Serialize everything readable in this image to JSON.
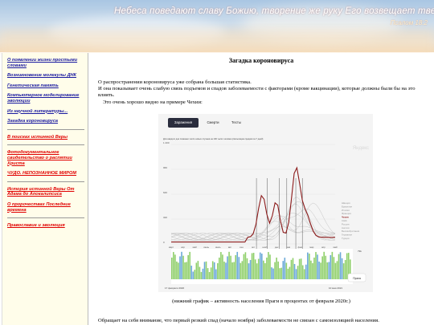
{
  "header": {
    "quote": "Небеса поведают славу Божию, творение же руку Его возвещает твердь",
    "reference": "Псалом 18:2"
  },
  "sidebar": {
    "items": [
      {
        "label": "О появлении жизни простыми словами",
        "color": "blue"
      },
      {
        "label": "Возникновение молекулы ДНК",
        "color": "blue"
      },
      {
        "label": "Генетическая память",
        "color": "blue"
      },
      {
        "label": "Компьютерное моделирование эволюции",
        "color": "blue"
      },
      {
        "label": "Из научной литературы...",
        "color": "blue"
      },
      {
        "label": "Загадка короновируса",
        "color": "blue"
      },
      {
        "label": "В поисках истинной Веры",
        "color": "red"
      },
      {
        "label": "Фотодокументальное свидетельство о распятии Христа",
        "color": "red"
      },
      {
        "label": "ЧУДО. НЕПОЗНАННОЕ МИРОМ",
        "color": "red"
      },
      {
        "label": "История истинной Веры От Адама до Апокалипсиса",
        "color": "red"
      },
      {
        "label": "О пророчествах Последние времена",
        "color": "red"
      },
      {
        "label": "Православие и эволюция",
        "color": "red"
      }
    ]
  },
  "main": {
    "title": "Загадка короновируса",
    "para1": "О распространении короновируса уже собрана большая статистика.",
    "para2": "И она показывает очень слабую связь подъемов и спадов заболеваемости с факторами (кроме вакцинации), которые должны были бы на это влиять.",
    "para3": "Это очень хорошо видно на примере Чехии:",
    "caption": "(нижний график – активность населения Праги в процентах от февраля 2020г.)",
    "bottom": "Обращает на себя внимание, что первый резкий спад (начало ноября) заболеваемости не связан с самоизоляцией населения."
  },
  "chart": {
    "tabs": [
      "Заражения",
      "Смерти",
      "Тесты"
    ],
    "subtitle": "Для каждого дня показано число новых случаев на 100 тысяч человек (скользящая средняя за 7 дней)",
    "watermark": "Яндекс",
    "y_ticks": [
      "1 200",
      "960",
      "640",
      "320",
      "0"
    ],
    "x_ticks": [
      "март",
      "апр",
      "май",
      "июнь",
      "июль",
      "авг",
      "сен",
      "окт",
      "нояб",
      "дек",
      "янв",
      "фев",
      "мар",
      "апр",
      "май"
    ],
    "legend": [
      "Швеция",
      "Бразилия",
      "Италия",
      "Франция",
      "Чехия",
      "США",
      "Россия",
      "Англия",
      "Великобритания",
      "Германия",
      "Турция"
    ],
    "highlight": "Чехия",
    "highlight_color": "#8b1a1a",
    "mobility_top": "79k",
    "mobility_dates": [
      "17 февраля 2020",
      "10 мая 2021"
    ],
    "mobility_city": "Прага"
  }
}
